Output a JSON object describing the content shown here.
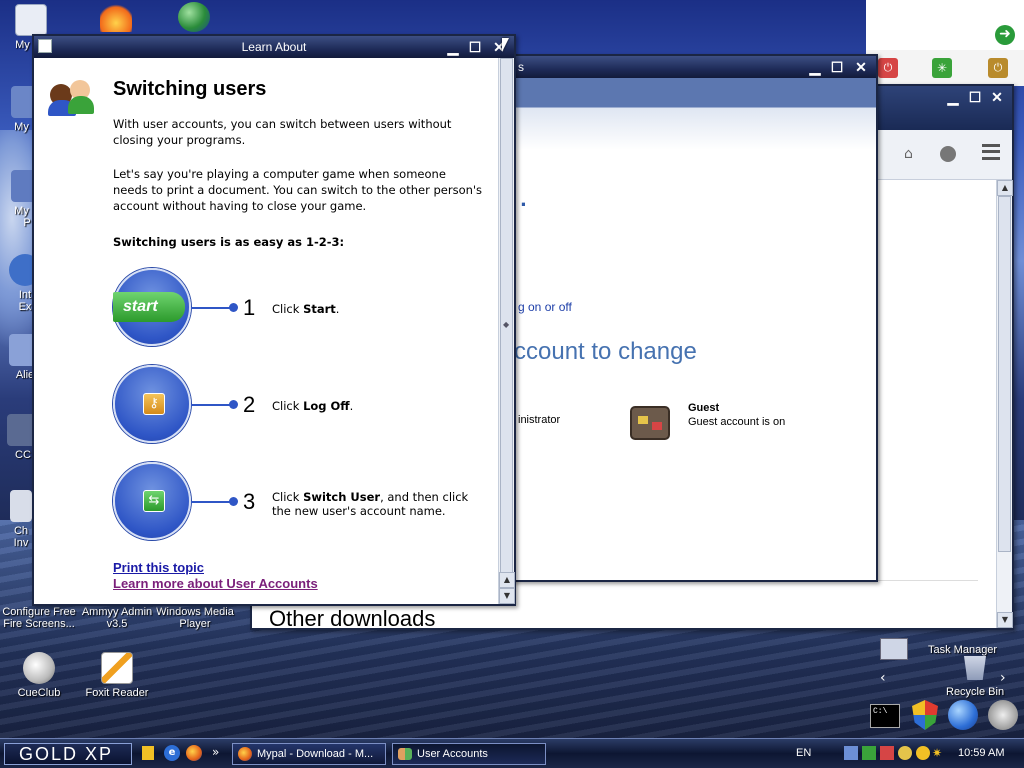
{
  "desktop": {
    "icons": [
      {
        "id": "mydocs",
        "label": "My Do",
        "x": 0
      },
      {
        "id": "mycomp",
        "label": "My C"
      },
      {
        "id": "mynet",
        "label": "My N\nP"
      },
      {
        "id": "ie",
        "label": "Int\nEx"
      },
      {
        "id": "alien",
        "label": "Alie"
      },
      {
        "id": "cc",
        "label": "CC"
      },
      {
        "id": "chinv",
        "label": "Ch\nInv"
      },
      {
        "id": "configure",
        "label": "Configure Free\nFire Screens..."
      },
      {
        "id": "ammyy",
        "label": "Ammyy Admin\nv3.5"
      },
      {
        "id": "wmp",
        "label": "Windows Media\nPlayer"
      },
      {
        "id": "cueclub",
        "label": "CueClub"
      },
      {
        "id": "foxit",
        "label": "Foxit Reader"
      }
    ],
    "right_icons": {
      "task_manager": "Task Manager",
      "recycle_bin": "Recycle Bin"
    }
  },
  "help_window": {
    "title": "Learn About",
    "heading": "Switching users",
    "para1": "With user accounts, you can switch between users without closing your programs.",
    "para2": "Let's say you're playing a computer game when someone needs to print a document. You can switch to the other person's account without having to close your game.",
    "steps_heading": "Switching users is as easy as 1-2-3:",
    "steps": [
      {
        "num": "1",
        "pre": "Click ",
        "bold": "Start",
        "post": ".",
        "badge": "start"
      },
      {
        "num": "2",
        "pre": "Click ",
        "bold": "Log Off",
        "post": "."
      },
      {
        "num": "3",
        "pre": "Click ",
        "bold": "Switch User",
        "post": ", and then click the new user's account name."
      }
    ],
    "link_print": "Print this topic",
    "link_learn": "Learn more about User Accounts"
  },
  "user_accounts_window": {
    "title_fragment": "s",
    "link_fragment": "g on or off",
    "heading_fragment": "ccount to change",
    "dot": ".",
    "admin_fragment": "inistrator",
    "guest_name": "Guest",
    "guest_status": "Guest account is on"
  },
  "browser_window": {
    "bottom_text": "Other downloads"
  },
  "taskbar": {
    "start_label": "GOLD XP",
    "chevron": "»",
    "tasks": [
      {
        "label": "Mypal - Download - M..."
      },
      {
        "label": "User Accounts"
      }
    ],
    "lang": "EN",
    "clock": "10:59 AM"
  }
}
